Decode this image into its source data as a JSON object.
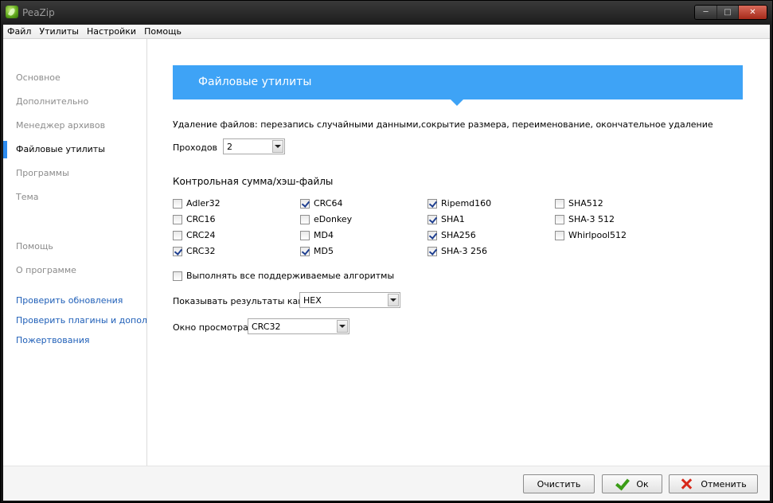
{
  "window": {
    "title": "PeaZip"
  },
  "menu": [
    "Файл",
    "Утилиты",
    "Настройки",
    "Помощь"
  ],
  "sidebar": {
    "items": [
      {
        "label": "Основное",
        "active": false
      },
      {
        "label": "Дополнительно",
        "active": false
      },
      {
        "label": "Менеджер архивов",
        "active": false
      },
      {
        "label": "Файловые утилиты",
        "active": true
      },
      {
        "label": "Программы",
        "active": false
      },
      {
        "label": "Тема",
        "active": false
      }
    ],
    "secondary": [
      {
        "label": "Помощь"
      },
      {
        "label": "О программе"
      }
    ],
    "links": [
      {
        "label": "Проверить обновления"
      },
      {
        "label": "Проверить плагины и дополнения"
      },
      {
        "label": "Пожертвования"
      }
    ]
  },
  "main": {
    "header": "Файловые утилиты",
    "delete_description": "Удаление файлов: перезапись случайными данными,сокрытие размера, переименование, окончательное удаление",
    "passes": {
      "label": "Проходов",
      "value": "2"
    },
    "checksum_title": "Контрольная сумма/хэш-файлы",
    "algorithms": [
      [
        {
          "label": "Adler32",
          "checked": false
        },
        {
          "label": "CRC16",
          "checked": false
        },
        {
          "label": "CRC24",
          "checked": false
        },
        {
          "label": "CRC32",
          "checked": true
        }
      ],
      [
        {
          "label": "CRC64",
          "checked": true
        },
        {
          "label": "eDonkey",
          "checked": false
        },
        {
          "label": "MD4",
          "checked": false
        },
        {
          "label": "MD5",
          "checked": true
        }
      ],
      [
        {
          "label": "Ripemd160",
          "checked": true
        },
        {
          "label": "SHA1",
          "checked": true
        },
        {
          "label": "SHA256",
          "checked": true
        },
        {
          "label": "SHA-3 256",
          "checked": true
        }
      ],
      [
        {
          "label": "SHA512",
          "checked": false
        },
        {
          "label": "SHA-3 512",
          "checked": false
        },
        {
          "label": "Whirlpool512",
          "checked": false
        }
      ]
    ],
    "run_all": {
      "label": "Выполнять все поддерживаемые алгоритмы",
      "checked": false
    },
    "show_results": {
      "label": "Показывать результаты как",
      "value": "HEX"
    },
    "preview": {
      "label": "Окно просмотра",
      "value": "CRC32"
    }
  },
  "footer": {
    "clear": "Очистить",
    "ok": "Ок",
    "cancel": "Отменить"
  },
  "colors": {
    "accent": "#3ea3f6",
    "link": "#1f5fb8",
    "ok_icon": "#3a9c16",
    "cancel_icon": "#d8281a"
  }
}
